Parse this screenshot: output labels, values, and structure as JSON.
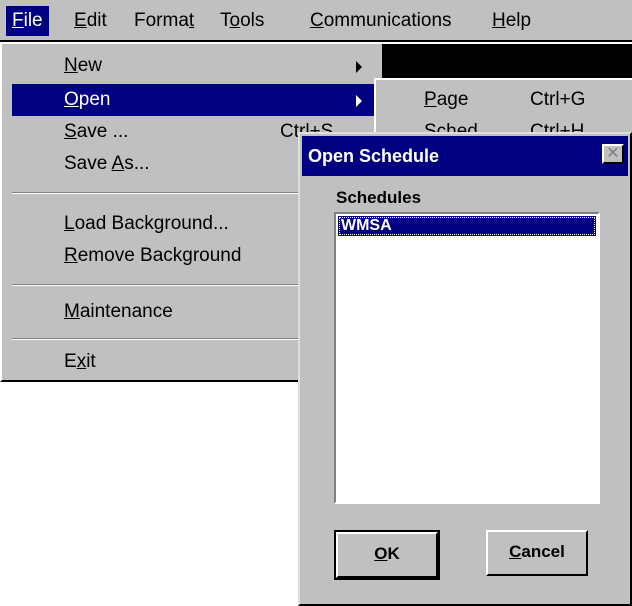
{
  "menubar": {
    "items": [
      {
        "label": "File",
        "mnemonic": "F",
        "active": true
      },
      {
        "label": "Edit",
        "mnemonic": "E"
      },
      {
        "label": "Format",
        "mnemonic": "t"
      },
      {
        "label": "Tools",
        "mnemonic": "o"
      },
      {
        "label": "Communications",
        "mnemonic": "C"
      },
      {
        "label": "Help",
        "mnemonic": "H"
      }
    ]
  },
  "file_menu": {
    "items": [
      {
        "label": "New",
        "has_submenu": true
      },
      {
        "label": "Open",
        "has_submenu": true,
        "highlighted": true
      },
      {
        "label": "Save ...",
        "shortcut": "Ctrl+S"
      },
      {
        "label": "Save As..."
      },
      {
        "label": "Load Background..."
      },
      {
        "label": "Remove Background"
      },
      {
        "label": "Maintenance"
      },
      {
        "label": "Exit"
      }
    ]
  },
  "open_submenu": {
    "items": [
      {
        "label": "Page",
        "shortcut": "Ctrl+G"
      },
      {
        "label": "Sched...",
        "shortcut": "Ctrl+H"
      }
    ]
  },
  "dialog": {
    "title": "Open Schedule",
    "list_label": "Schedules",
    "list_items": [
      "WMSA"
    ],
    "selected_item": "WMSA",
    "ok_label": "OK",
    "cancel_label": "Cancel"
  },
  "colors": {
    "highlight": "#000080",
    "face": "#c0c0c0"
  }
}
